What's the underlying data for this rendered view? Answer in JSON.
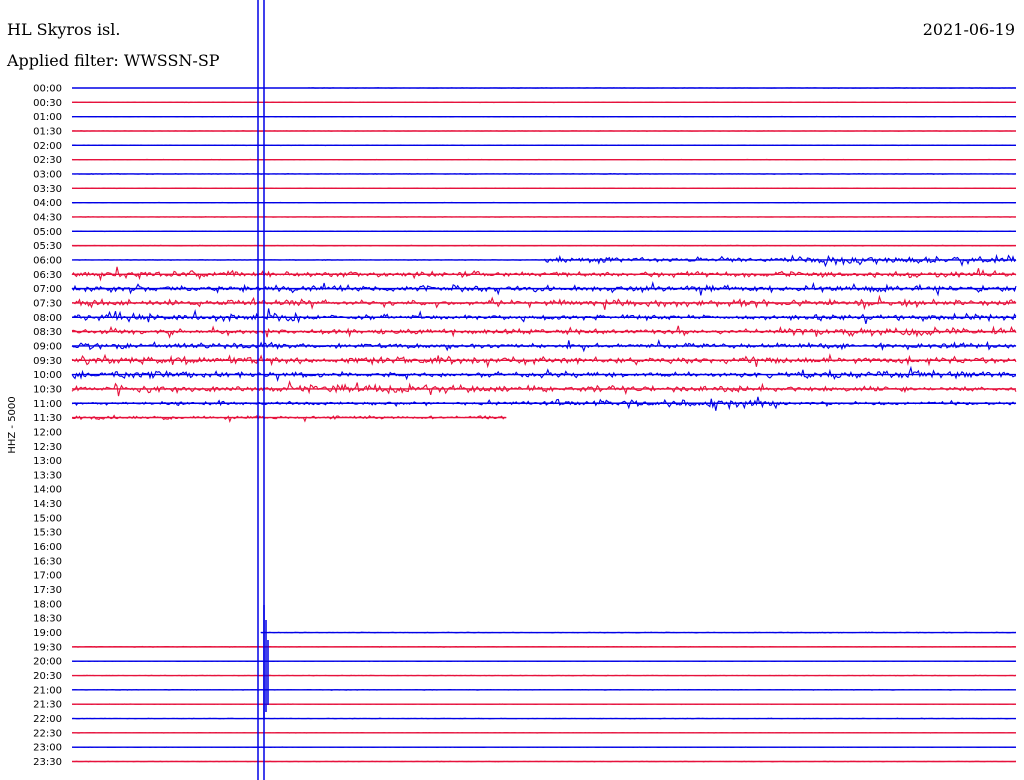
{
  "header": {
    "station": "HL Skyros isl.",
    "filter": "Applied filter: WWSSN-SP",
    "date": "2021-06-19"
  },
  "chart_data": {
    "type": "line",
    "title": "HL Skyros isl.",
    "channel_label": "HHZ - 5000",
    "colors": {
      "even": "#0000e6",
      "odd": "#e6123c"
    },
    "rows": [
      {
        "label": "00:00",
        "activity": [
          0,
          0.3,
          0.3,
          0.3
        ]
      },
      {
        "label": "00:30",
        "activity": [
          0.3,
          0.3,
          0.3,
          0.3
        ]
      },
      {
        "label": "01:00",
        "activity": [
          0.3,
          0.3,
          0.3,
          0.3
        ]
      },
      {
        "label": "01:30",
        "activity": [
          0.3,
          0.3,
          0.3,
          0.3
        ]
      },
      {
        "label": "02:00",
        "activity": [
          0.3,
          0.3,
          0.3,
          0.3
        ]
      },
      {
        "label": "02:30",
        "activity": [
          0.3,
          0.3,
          0.3,
          0.3
        ]
      },
      {
        "label": "03:00",
        "activity": [
          0.4,
          0.4,
          0.4,
          0.4
        ]
      },
      {
        "label": "03:30",
        "activity": [
          0.3,
          0.3,
          0.3,
          0.3
        ]
      },
      {
        "label": "04:00",
        "activity": [
          0.3,
          0.3,
          0.3,
          0.3
        ]
      },
      {
        "label": "04:30",
        "activity": [
          0.3,
          0.3,
          0.3,
          0.3
        ]
      },
      {
        "label": "05:00",
        "activity": [
          0.3,
          0.3,
          0.3,
          0.3
        ]
      },
      {
        "label": "05:30",
        "activity": [
          0.4,
          0.4,
          0.4,
          0.4
        ]
      },
      {
        "label": "06:00",
        "activity": [
          0.4,
          0.4,
          3,
          5
        ]
      },
      {
        "label": "06:30",
        "activity": [
          4,
          3,
          3,
          4
        ]
      },
      {
        "label": "07:00",
        "activity": [
          4,
          4,
          4,
          4
        ]
      },
      {
        "label": "07:30",
        "activity": [
          4,
          3,
          4,
          4
        ]
      },
      {
        "label": "08:00",
        "activity": [
          5,
          3,
          3,
          4
        ]
      },
      {
        "label": "08:30",
        "activity": [
          3,
          3,
          3,
          5
        ]
      },
      {
        "label": "09:00",
        "activity": [
          4,
          3,
          3,
          4
        ]
      },
      {
        "label": "09:30",
        "activity": [
          5,
          4,
          4,
          4
        ]
      },
      {
        "label": "10:00",
        "activity": [
          5,
          3,
          3,
          5
        ]
      },
      {
        "label": "10:30",
        "activity": [
          4,
          5,
          4,
          3
        ]
      },
      {
        "label": "11:00",
        "activity": [
          2,
          2,
          5,
          2
        ]
      },
      {
        "label": "11:30",
        "activity": [
          2,
          2,
          0,
          0
        ],
        "end": 0.46
      },
      {
        "label": "12:00",
        "empty": true
      },
      {
        "label": "12:30",
        "empty": true
      },
      {
        "label": "13:00",
        "empty": true
      },
      {
        "label": "13:30",
        "empty": true
      },
      {
        "label": "14:00",
        "empty": true
      },
      {
        "label": "14:30",
        "empty": true
      },
      {
        "label": "15:00",
        "empty": true
      },
      {
        "label": "15:30",
        "empty": true
      },
      {
        "label": "16:00",
        "empty": true
      },
      {
        "label": "16:30",
        "empty": true
      },
      {
        "label": "17:00",
        "empty": true
      },
      {
        "label": "17:30",
        "empty": true
      },
      {
        "label": "18:00",
        "empty": true
      },
      {
        "label": "18:30",
        "empty": true
      },
      {
        "label": "19:00",
        "activity": [
          0.4,
          0.4,
          0.4,
          0.4
        ],
        "start": 0.2
      },
      {
        "label": "19:30",
        "activity": [
          0.4,
          0.4,
          0.4,
          0.4
        ]
      },
      {
        "label": "20:00",
        "activity": [
          0.3,
          0.3,
          0.3,
          0.3
        ]
      },
      {
        "label": "20:30",
        "activity": [
          0.3,
          0.3,
          0.3,
          0.3
        ]
      },
      {
        "label": "21:00",
        "activity": [
          0.4,
          0.4,
          0.4,
          0.4
        ]
      },
      {
        "label": "21:30",
        "activity": [
          0.3,
          0.3,
          0.3,
          0.3
        ]
      },
      {
        "label": "22:00",
        "activity": [
          0.3,
          0.3,
          0.3,
          0.3
        ]
      },
      {
        "label": "22:30",
        "activity": [
          0.3,
          0.3,
          0.3,
          0.3
        ]
      },
      {
        "label": "23:00",
        "activity": [
          0.3,
          0.3,
          0.3,
          0.3
        ]
      },
      {
        "label": "23:30",
        "activity": [
          0.3,
          0.3,
          0.3,
          0.3
        ]
      }
    ],
    "grid": false
  }
}
